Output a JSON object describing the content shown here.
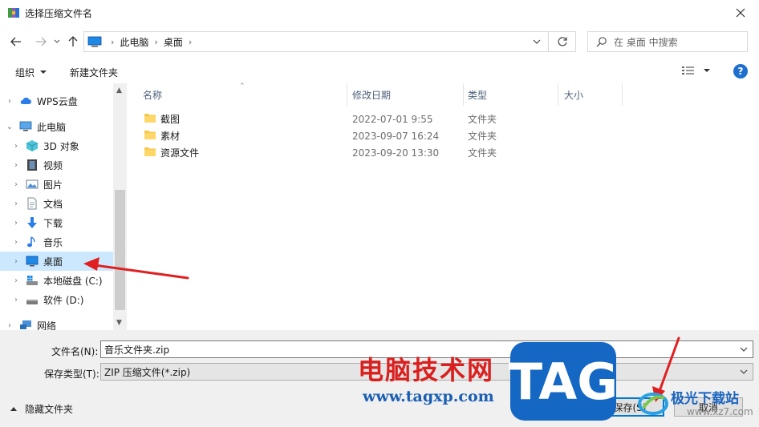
{
  "window": {
    "title": "选择压缩文件名"
  },
  "nav": {
    "breadcrumbs": [
      "此电脑",
      "桌面"
    ],
    "search_placeholder": "在 桌面 中搜索"
  },
  "toolbar": {
    "organize": "组织",
    "new_folder": "新建文件夹"
  },
  "sidebar": {
    "items": [
      {
        "label": "WPS云盘",
        "icon": "cloud-icon"
      },
      {
        "label": "此电脑",
        "icon": "computer-icon"
      },
      {
        "label": "3D 对象",
        "icon": "3d-objects-icon"
      },
      {
        "label": "视频",
        "icon": "video-icon"
      },
      {
        "label": "图片",
        "icon": "pictures-icon"
      },
      {
        "label": "文档",
        "icon": "documents-icon"
      },
      {
        "label": "下载",
        "icon": "download-icon"
      },
      {
        "label": "音乐",
        "icon": "music-icon"
      },
      {
        "label": "桌面",
        "icon": "desktop-icon"
      },
      {
        "label": "本地磁盘 (C:)",
        "icon": "disk-c-icon"
      },
      {
        "label": "软件 (D:)",
        "icon": "disk-d-icon"
      },
      {
        "label": "网络",
        "icon": "network-icon"
      }
    ],
    "selected": "桌面"
  },
  "columns": {
    "name": "名称",
    "date": "修改日期",
    "type": "类型",
    "size": "大小"
  },
  "files": [
    {
      "name": "截图",
      "date": "2022-07-01 9:55",
      "type": "文件夹"
    },
    {
      "name": "素材",
      "date": "2023-09-07 16:24",
      "type": "文件夹"
    },
    {
      "name": "资源文件",
      "date": "2023-09-20 13:30",
      "type": "文件夹"
    }
  ],
  "form": {
    "filename_label": "文件名(N):",
    "filename_value": "音乐文件夹.zip",
    "filetype_label": "保存类型(T):",
    "filetype_value": "ZIP 压缩文件(*.zip)"
  },
  "footer": {
    "hide_folders": "隐藏文件夹",
    "save": "保存(S)",
    "cancel": "取消"
  },
  "watermark": {
    "text": "电脑技术网",
    "url": "www.tagxp.com",
    "tag": "TAG"
  },
  "logo": {
    "brand": "极光下载站",
    "url": "www.xz7.com"
  },
  "colors": {
    "selection": "#cce8ff",
    "accent": "#0078d7",
    "annotation_arrow": "#e02020"
  }
}
